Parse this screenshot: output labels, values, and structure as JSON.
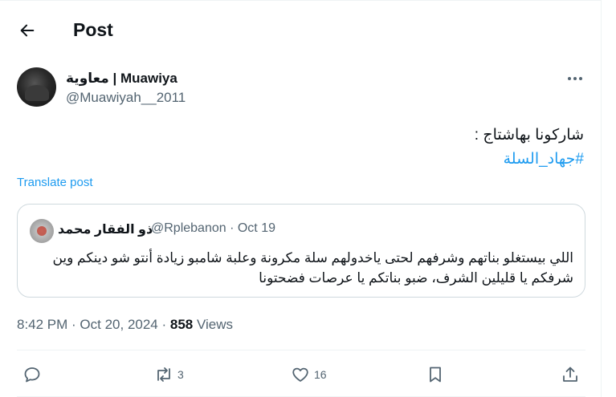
{
  "header": {
    "title": "Post",
    "back_icon": "arrow-left-icon"
  },
  "author": {
    "display_name": "معاوية | Muawiya",
    "handle": "@Muawiyah__2011"
  },
  "tweet": {
    "line1": "شاركونا بهاشتاج :",
    "hashtag": "#جهاد_السلة",
    "translate_label": "Translate post"
  },
  "quote": {
    "name": "ذو الفقار محمد",
    "handle_date": "@Rplebanon · Oct 19",
    "text": "اللي بيستغلو بناتهم وشرفهم لحتى ياخدولهم سلة مكرونة وعلبة شامبو زيادة أنتو شو دينكم وين شرفكم يا قليلين الشرف، ضبو بناتكم يا عرصات فضحتونا"
  },
  "meta": {
    "time_date": "8:42 PM · Oct 20, 2024 · ",
    "views_count": "858",
    "views_label": " Views"
  },
  "actions": {
    "reply_count": "",
    "repost_count": "3",
    "like_count": "16"
  },
  "colors": {
    "accent": "#1d9bf0",
    "muted": "#536471",
    "text": "#0f1419",
    "border": "#cfd9de"
  }
}
